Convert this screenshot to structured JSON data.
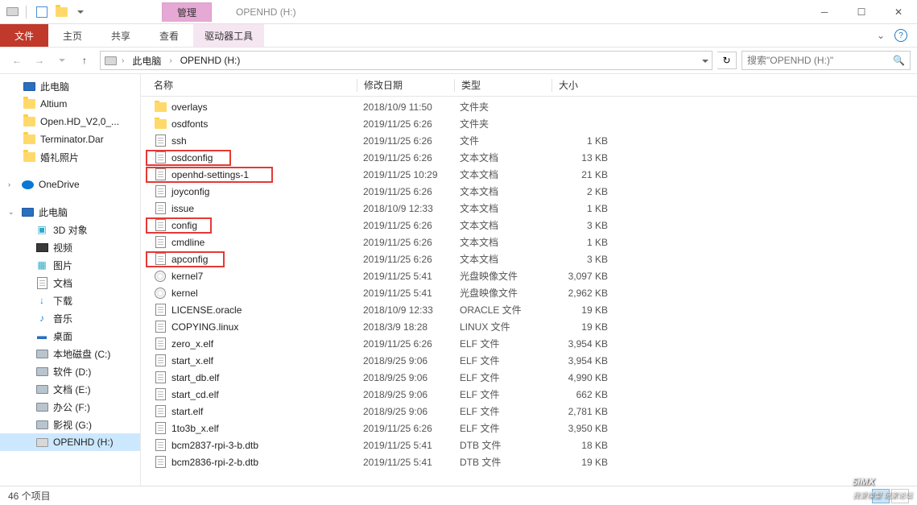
{
  "titlebar": {
    "title": "OPENHD (H:)",
    "manage": "管理"
  },
  "ribbon": {
    "file": "文件",
    "home": "主页",
    "share": "共享",
    "view": "查看",
    "drive_tools": "驱动器工具"
  },
  "nav": {
    "crumbs": [
      "此电脑",
      "OPENHD (H:)"
    ],
    "search_placeholder": "搜索\"OPENHD (H:)\""
  },
  "tree": {
    "quick": [
      {
        "label": "此电脑",
        "ico": "pc"
      },
      {
        "label": "Altium",
        "ico": "folder"
      },
      {
        "label": "Open.HD_V2,0_...",
        "ico": "folder"
      },
      {
        "label": "Terminator.Dar",
        "ico": "folder"
      },
      {
        "label": "婚礼照片",
        "ico": "folder"
      }
    ],
    "onedrive": "OneDrive",
    "thispc": {
      "label": "此电脑",
      "children": [
        {
          "label": "3D 对象",
          "ico": "3d"
        },
        {
          "label": "视频",
          "ico": "media"
        },
        {
          "label": "图片",
          "ico": "pic"
        },
        {
          "label": "文档",
          "ico": "doc"
        },
        {
          "label": "下载",
          "ico": "dl"
        },
        {
          "label": "音乐",
          "ico": "music"
        },
        {
          "label": "桌面",
          "ico": "desk"
        },
        {
          "label": "本地磁盘 (C:)",
          "ico": "drive"
        },
        {
          "label": "软件 (D:)",
          "ico": "drive"
        },
        {
          "label": "文档 (E:)",
          "ico": "drive"
        },
        {
          "label": "办公 (F:)",
          "ico": "drive"
        },
        {
          "label": "影视 (G:)",
          "ico": "drive"
        },
        {
          "label": "OPENHD (H:)",
          "ico": "usb",
          "selected": true
        }
      ]
    }
  },
  "columns": {
    "name": "名称",
    "date": "修改日期",
    "type": "类型",
    "size": "大小"
  },
  "files": [
    {
      "ico": "folder",
      "name": "overlays",
      "date": "2018/10/9 11:50",
      "type": "文件夹",
      "size": ""
    },
    {
      "ico": "folder",
      "name": "osdfonts",
      "date": "2019/11/25 6:26",
      "type": "文件夹",
      "size": ""
    },
    {
      "ico": "doc",
      "name": "ssh",
      "date": "2019/11/25 6:26",
      "type": "文件",
      "size": "1 KB"
    },
    {
      "ico": "doc",
      "name": "osdconfig",
      "date": "2019/11/25 6:26",
      "type": "文本文档",
      "size": "13 KB",
      "hl": true,
      "hlw": 106
    },
    {
      "ico": "doc",
      "name": "openhd-settings-1",
      "date": "2019/11/25 10:29",
      "type": "文本文档",
      "size": "21 KB",
      "hl": true,
      "hlw": 158
    },
    {
      "ico": "doc",
      "name": "joyconfig",
      "date": "2019/11/25 6:26",
      "type": "文本文档",
      "size": "2 KB"
    },
    {
      "ico": "doc",
      "name": "issue",
      "date": "2018/10/9 12:33",
      "type": "文本文档",
      "size": "1 KB"
    },
    {
      "ico": "doc",
      "name": "config",
      "date": "2019/11/25 6:26",
      "type": "文本文档",
      "size": "3 KB",
      "hl": true,
      "hlw": 82
    },
    {
      "ico": "doc",
      "name": "cmdline",
      "date": "2019/11/25 6:26",
      "type": "文本文档",
      "size": "1 KB"
    },
    {
      "ico": "doc",
      "name": "apconfig",
      "date": "2019/11/25 6:26",
      "type": "文本文档",
      "size": "3 KB",
      "hl": true,
      "hlw": 98
    },
    {
      "ico": "disc",
      "name": "kernel7",
      "date": "2019/11/25 5:41",
      "type": "光盘映像文件",
      "size": "3,097 KB"
    },
    {
      "ico": "disc",
      "name": "kernel",
      "date": "2019/11/25 5:41",
      "type": "光盘映像文件",
      "size": "2,962 KB"
    },
    {
      "ico": "doc",
      "name": "LICENSE.oracle",
      "date": "2018/10/9 12:33",
      "type": "ORACLE 文件",
      "size": "19 KB"
    },
    {
      "ico": "doc",
      "name": "COPYING.linux",
      "date": "2018/3/9 18:28",
      "type": "LINUX 文件",
      "size": "19 KB"
    },
    {
      "ico": "doc",
      "name": "zero_x.elf",
      "date": "2019/11/25 6:26",
      "type": "ELF 文件",
      "size": "3,954 KB"
    },
    {
      "ico": "doc",
      "name": "start_x.elf",
      "date": "2018/9/25 9:06",
      "type": "ELF 文件",
      "size": "3,954 KB"
    },
    {
      "ico": "doc",
      "name": "start_db.elf",
      "date": "2018/9/25 9:06",
      "type": "ELF 文件",
      "size": "4,990 KB"
    },
    {
      "ico": "doc",
      "name": "start_cd.elf",
      "date": "2018/9/25 9:06",
      "type": "ELF 文件",
      "size": "662 KB"
    },
    {
      "ico": "doc",
      "name": "start.elf",
      "date": "2018/9/25 9:06",
      "type": "ELF 文件",
      "size": "2,781 KB"
    },
    {
      "ico": "doc",
      "name": "1to3b_x.elf",
      "date": "2019/11/25 6:26",
      "type": "ELF 文件",
      "size": "3,950 KB"
    },
    {
      "ico": "doc",
      "name": "bcm2837-rpi-3-b.dtb",
      "date": "2019/11/25 5:41",
      "type": "DTB 文件",
      "size": "18 KB"
    },
    {
      "ico": "doc",
      "name": "bcm2836-rpi-2-b.dtb",
      "date": "2019/11/25 5:41",
      "type": "DTB 文件",
      "size": "19 KB"
    }
  ],
  "status": {
    "count": "46 个项目"
  },
  "watermark": {
    "brand": "5iMX",
    "sub": "我爱模型  玩家论坛"
  }
}
